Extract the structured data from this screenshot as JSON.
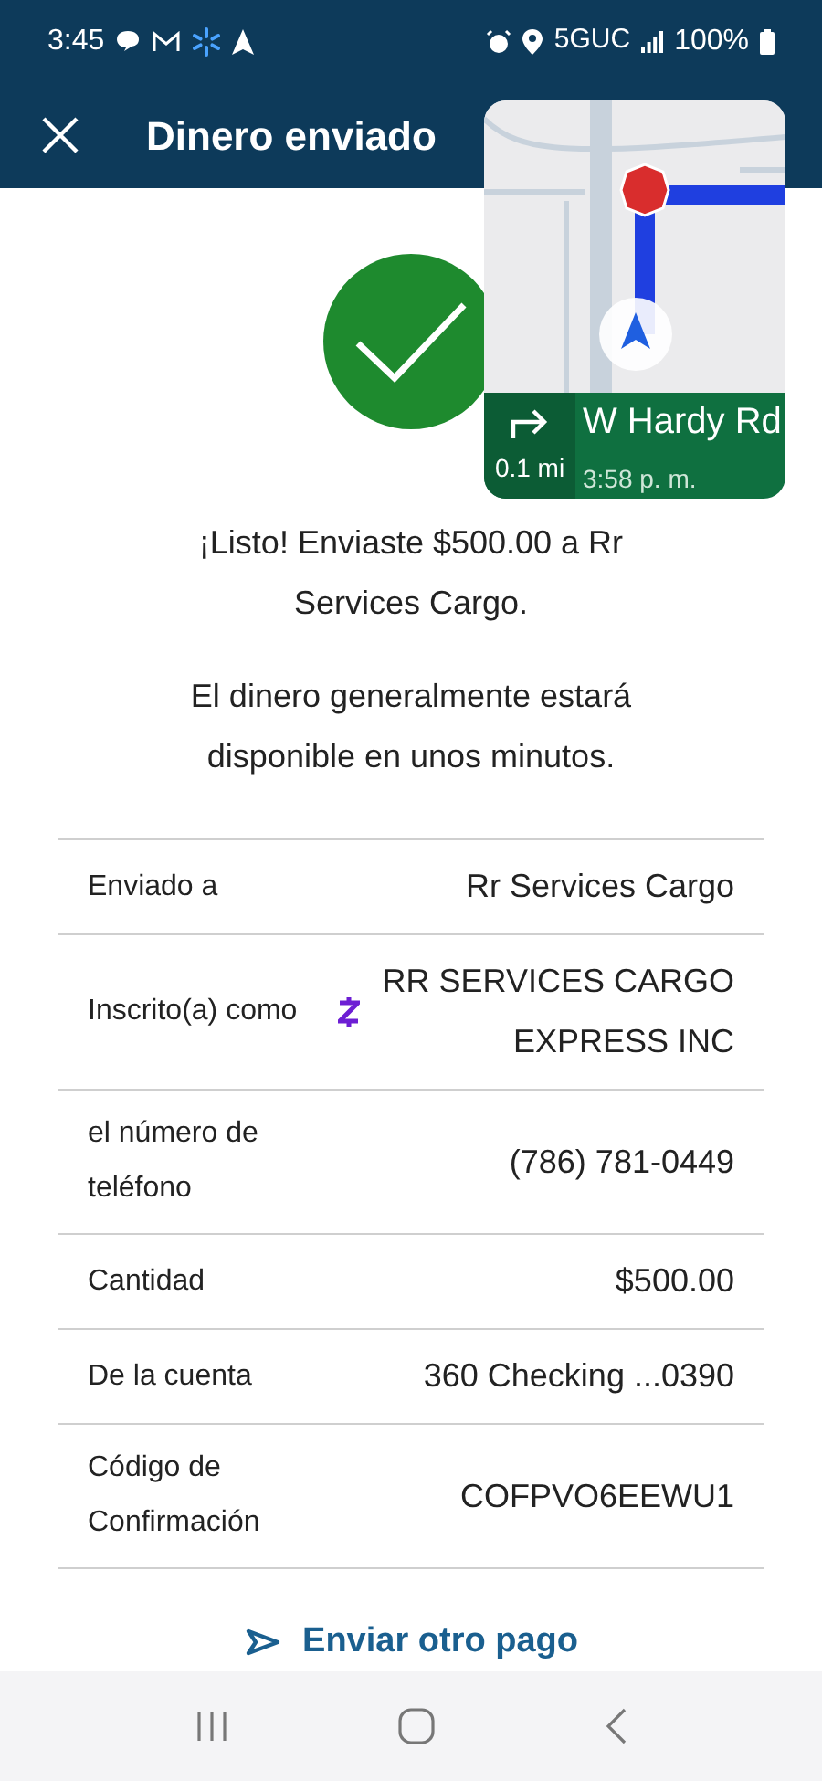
{
  "status_bar": {
    "time": "3:45",
    "network": "5GUC",
    "battery": "100%"
  },
  "header": {
    "title": "Dinero enviado"
  },
  "navigation_overlay": {
    "street": "W Hardy Rd",
    "distance": "0.1 mi",
    "arrival": "3:58 p. m."
  },
  "message": "¡Listo! Enviaste $500.00 a Rr Services Cargo.",
  "note": "El dinero generalmente estará disponible en unos minutos.",
  "details": [
    {
      "label": "Enviado a",
      "value": "Rr Services Cargo",
      "kind": "plain"
    },
    {
      "label": "Inscrito(a) como",
      "value": "RR SERVICES CARGO EXPRESS INC",
      "kind": "zelle"
    },
    {
      "label": "el número de teléfono",
      "value": "(786) 781-0449",
      "kind": "plain"
    },
    {
      "label": "Cantidad",
      "value": "$500.00",
      "kind": "plain"
    },
    {
      "label": "De la cuenta",
      "value": "360 Checking ...0390",
      "kind": "plain"
    },
    {
      "label": "Código de Confirmación",
      "value": "COFPVO6EEWU1",
      "kind": "plain"
    }
  ],
  "send_again": "Enviar otro pago"
}
